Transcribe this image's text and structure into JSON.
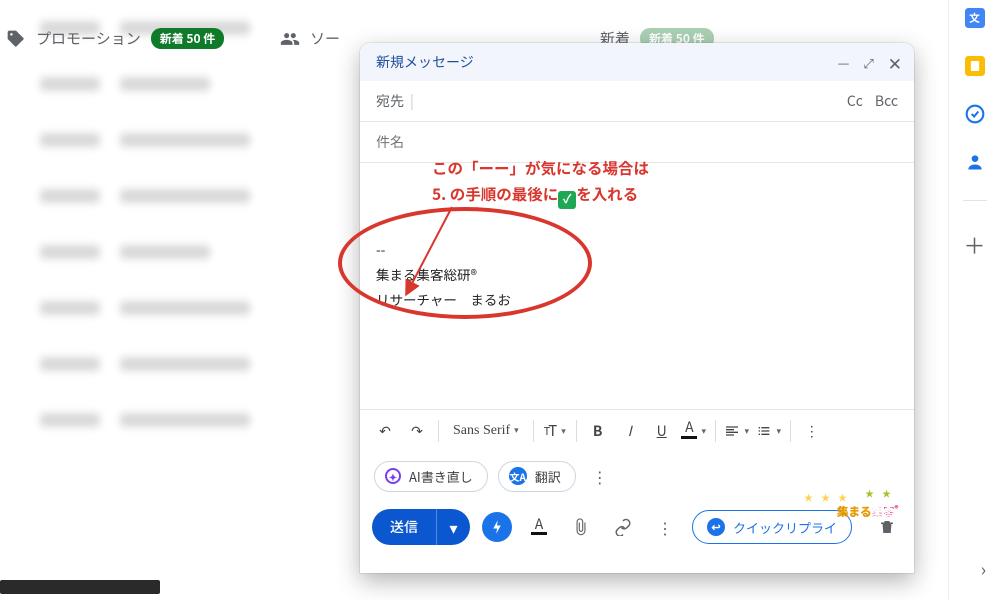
{
  "categories": {
    "promo": {
      "label": "プロモーション",
      "badge": "新着 50 件"
    },
    "social": {
      "label": "ソー"
    },
    "updates": {
      "label": "新着",
      "badge": "新着 50 件"
    }
  },
  "compose": {
    "title": "新規メッセージ",
    "to_label": "宛先",
    "cc": "Cc",
    "bcc": "Bcc",
    "subject_placeholder": "件名",
    "signature": {
      "dashes": "--",
      "line1": "集まる集客総研®",
      "line2": "リサーチャー　まるお"
    }
  },
  "annotation": {
    "line1": "この「ーー」が気になる場合は",
    "line2_a": "5. の手順の最後に",
    "line2_b": "を入れる",
    "check": "✓"
  },
  "format": {
    "font": "Sans Serif",
    "size": "ᵀT",
    "bold": "B",
    "italic": "I",
    "underline": "U",
    "text_color": "A"
  },
  "chips": {
    "ai": "AI書き直し",
    "translate": "翻訳",
    "translate_icon": "文A"
  },
  "actions": {
    "send": "送信",
    "quick": "クイックリプライ"
  },
  "watermark": {
    "a": "集まる",
    "b": "集客"
  }
}
